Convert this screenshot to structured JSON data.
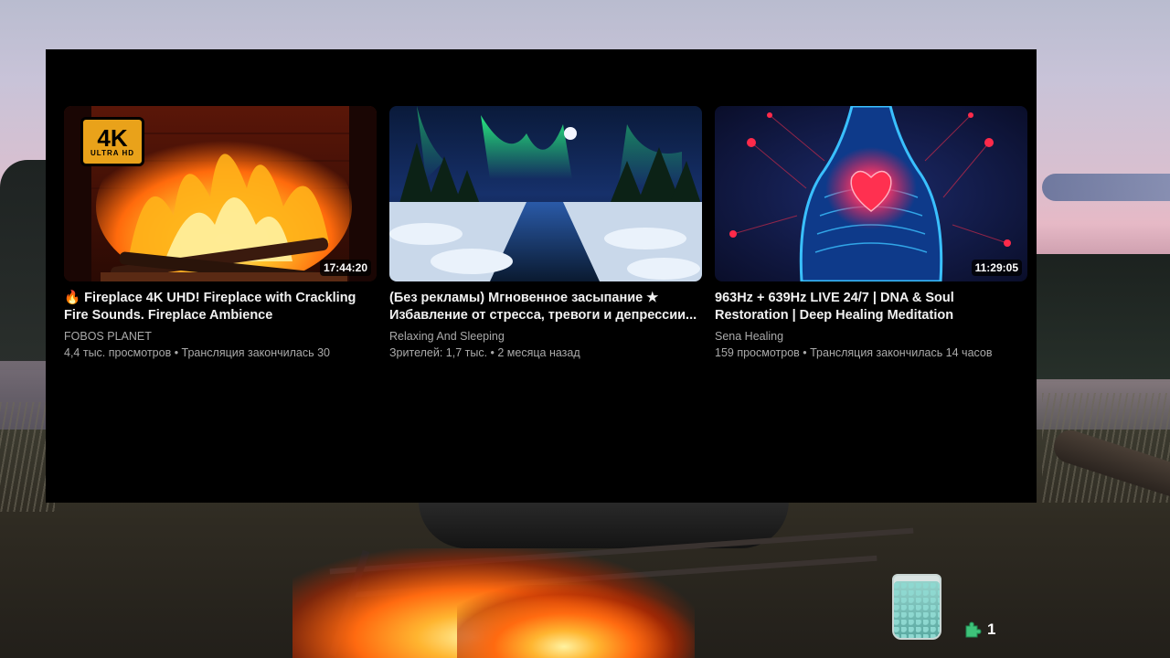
{
  "videos": [
    {
      "title_line1": "🔥 Fireplace 4K UHD! Fireplace with Crackling",
      "title_line2": "Fire Sounds. Fireplace Ambience",
      "channel": "FOBOS PLANET",
      "meta": "4,4 тыс. просмотров • Трансляция закончилась 30",
      "duration": "17:44:20",
      "badge_main": "4K",
      "badge_sub": "ULTRA HD"
    },
    {
      "title_line1": "(Без рекламы) Мгновенное засыпание ★",
      "title_line2": "Избавление от стресса, тревоги и депрессии...",
      "channel": "Relaxing And Sleeping",
      "meta": "Зрителей: 1,7 тыс. • 2 месяца назад"
    },
    {
      "title_line1": "963Hz + 639Hz LIVE 24/7 | DNA & Soul",
      "title_line2": "Restoration | Deep Healing Meditation",
      "channel": "Sena Healing",
      "meta": "159 просмотров • Трансляция закончилась 14 часов",
      "duration": "11:29:05"
    }
  ],
  "widgets": {
    "counter_value": "1",
    "jar_icon": "jar-icon",
    "counter_icon": "puzzle-piece-icon"
  },
  "colors": {
    "panel_bg": "#000000",
    "title_text": "#f1f1f1",
    "secondary_text": "#aaaaaa",
    "badge_4k": "#e9a21a",
    "counter_icon": "#3ec37a"
  }
}
